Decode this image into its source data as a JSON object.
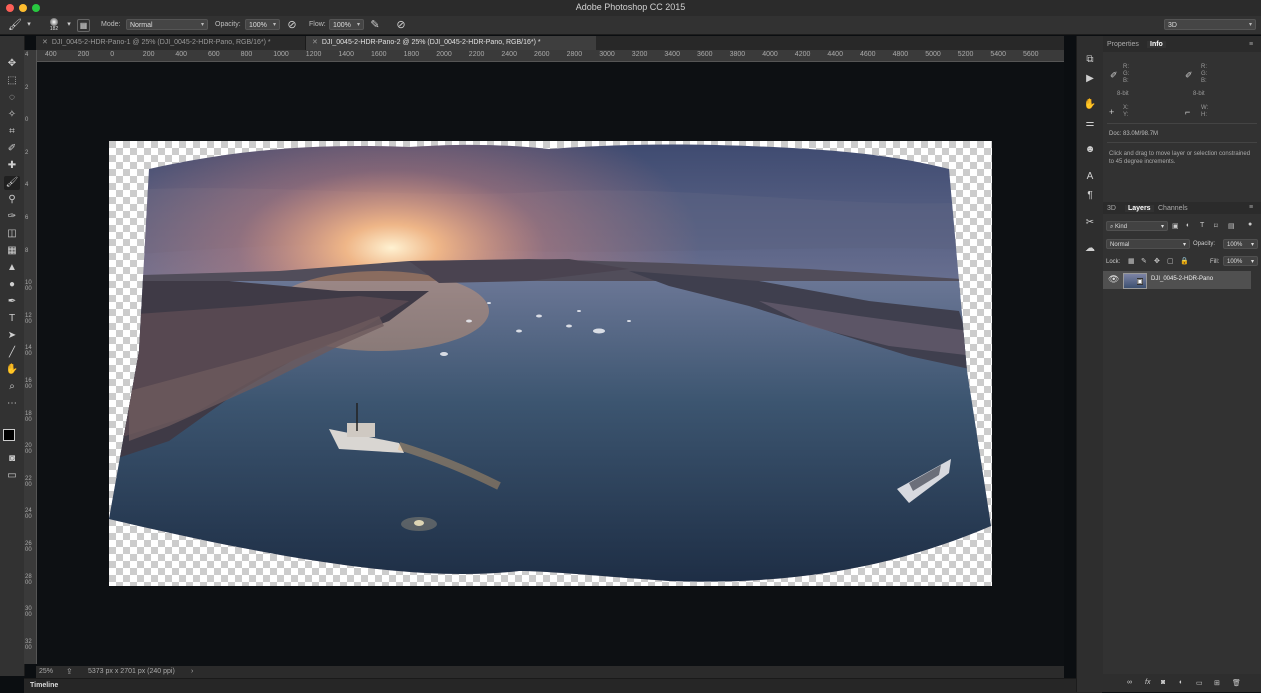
{
  "app": {
    "title": "Adobe Photoshop CC 2015"
  },
  "options": {
    "brush_size": "182",
    "mode_label": "Mode:",
    "mode_value": "Normal",
    "opacity_label": "Opacity:",
    "opacity_value": "100%",
    "flow_label": "Flow:",
    "flow_value": "100%",
    "workspace": "3D"
  },
  "tabs": [
    {
      "label": "DJI_0045-2-HDR-Pano-1 @ 25% (DJI_0045-2-HDR-Pano, RGB/16*) *",
      "active": false
    },
    {
      "label": "DJI_0045-2-HDR-Pano-2 @ 25% (DJI_0045-2-HDR-Pano, RGB/16*) *",
      "active": true
    }
  ],
  "ruler_h": [
    "400",
    "200",
    "0",
    "200",
    "400",
    "600",
    "800",
    "1000",
    "1200",
    "1400",
    "1600",
    "1800",
    "2000",
    "2200",
    "2400",
    "2600",
    "2800",
    "3000",
    "3200",
    "3400",
    "3600",
    "3800",
    "4000",
    "4200",
    "4400",
    "4600",
    "4800",
    "5000",
    "5200",
    "5400",
    "5600"
  ],
  "ruler_v": [
    "4",
    "2",
    "0",
    "2",
    "4",
    "6",
    "8",
    "1000",
    "1200",
    "1400",
    "1600",
    "1800",
    "2000",
    "2200",
    "2400",
    "2600",
    "2800",
    "3000",
    "3200"
  ],
  "status": {
    "zoom": "25%",
    "doc_dims": "5373 px x 2701 px (240 ppi)"
  },
  "timeline_label": "Timeline",
  "panels": {
    "properties_tab": "Properties",
    "info_tab": "Info",
    "rgb_r": "R:",
    "rgb_g": "G:",
    "rgb_b": "B:",
    "bit_depth": "8-bit",
    "xy_x": "X:",
    "xy_y": "Y:",
    "wh_w": "W:",
    "wh_h": "H:",
    "doc_size": "Doc: 83.0M/98.7M",
    "hint": "Click and drag to move layer or selection constrained to 45 degree increments."
  },
  "layers": {
    "tab_3d": "3D",
    "tab_layers": "Layers",
    "tab_channels": "Channels",
    "filter_kind": "Kind",
    "blend_mode": "Normal",
    "opacity_label": "Opacity:",
    "opacity_value": "100%",
    "lock_label": "Lock:",
    "fill_label": "Fill:",
    "fill_value": "100%",
    "layer_name": "DJI_0045-2-HDR-Pano"
  },
  "colors": {
    "accent": "#4a90e2",
    "panel_bg": "#323232",
    "canvas_bg": "#0d1013"
  }
}
